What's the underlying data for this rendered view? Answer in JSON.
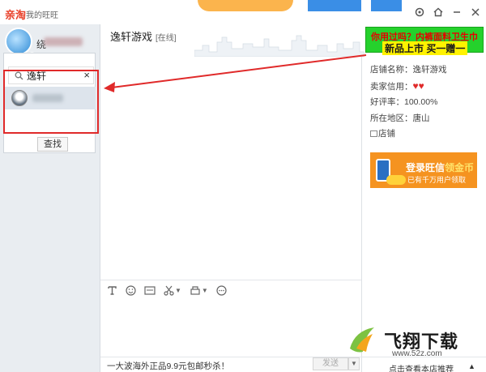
{
  "app": {
    "brand": "亲淘",
    "brand_sub": "我的旺旺"
  },
  "user": {
    "name_visible": "绕"
  },
  "search": {
    "query": "逸轩",
    "find_button": "查找"
  },
  "chat": {
    "title": "逸轩游戏",
    "status": "[在线]"
  },
  "ad_banner": {
    "line1": "你用过吗？内裤面料卫生巾",
    "line2": "新品上市  买一赠一"
  },
  "shop": {
    "name": "店铺名称：逸轩游戏",
    "seller_credit_label": "卖家信用：",
    "hearts": "♥♥",
    "rating": "好评率：100.00%",
    "region": "所在地区：唐山",
    "store_link": "店铺"
  },
  "promo": {
    "title_prefix": "登录旺信",
    "title_highlight": "领金币",
    "subtitle": "已有千万用户领取"
  },
  "toolbar": {
    "icons": [
      "text-format-icon",
      "emoji-icon",
      "screenshot-icon",
      "scissors-icon",
      "stamp-icon",
      "more-icon"
    ]
  },
  "bottom": {
    "marquee": "一大波海外正品9.9元包邮秒杀！",
    "send": "发送",
    "recommend": "点击查看本店推荐"
  },
  "watermark": {
    "title": "飞翔下载",
    "url": "www.52z.com"
  },
  "colors": {
    "highlight_red": "#e02a2a",
    "ad_green": "#25d12c",
    "promo_orange": "#f59320"
  }
}
